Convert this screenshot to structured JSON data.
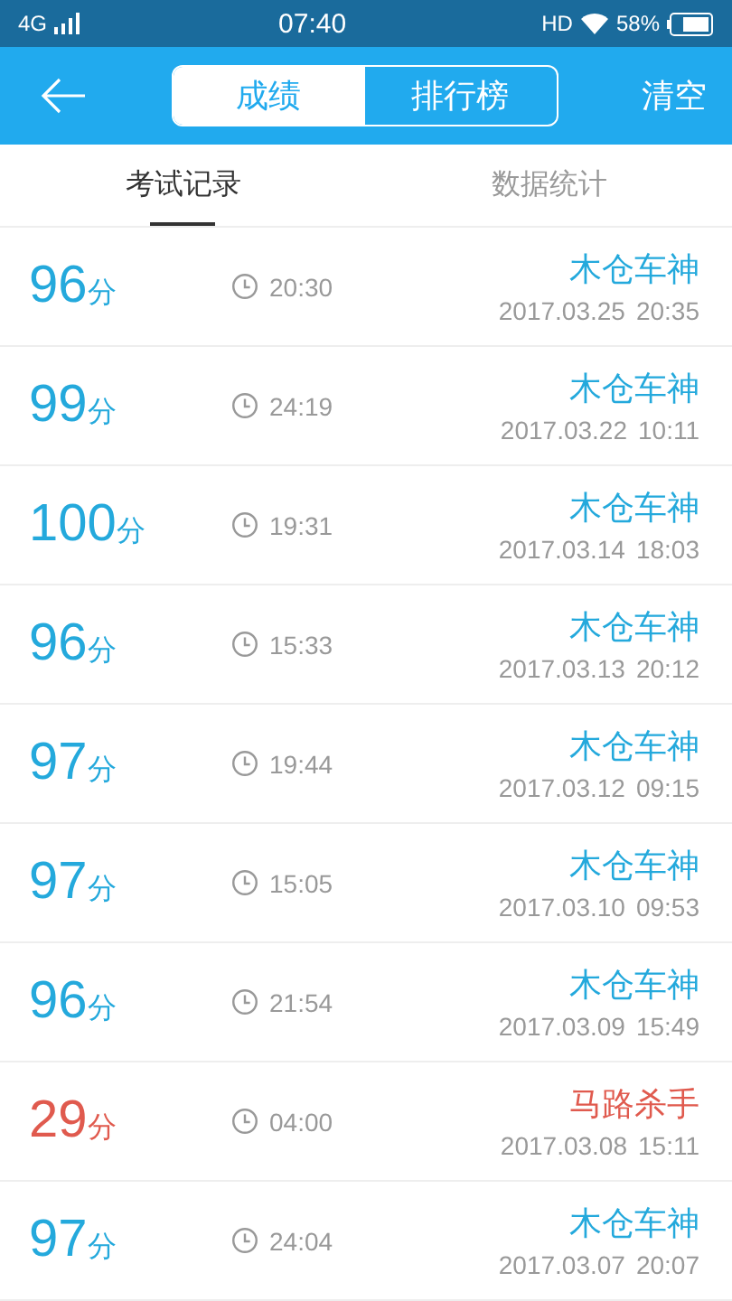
{
  "status_bar": {
    "network": "4G",
    "time": "07:40",
    "hd": "HD",
    "battery": "58%"
  },
  "header": {
    "segments": [
      {
        "label": "成绩",
        "selected": true
      },
      {
        "label": "排行榜",
        "selected": false
      }
    ],
    "action": "清空"
  },
  "tabs": [
    {
      "label": "考试记录",
      "selected": true
    },
    {
      "label": "数据统计",
      "selected": false
    }
  ],
  "records": [
    {
      "score": "96",
      "unit": "分",
      "duration": "20:30",
      "title": "木仓车神",
      "date": "2017.03.25",
      "time": "20:35",
      "passed": true
    },
    {
      "score": "99",
      "unit": "分",
      "duration": "24:19",
      "title": "木仓车神",
      "date": "2017.03.22",
      "time": "10:11",
      "passed": true
    },
    {
      "score": "100",
      "unit": "分",
      "duration": "19:31",
      "title": "木仓车神",
      "date": "2017.03.14",
      "time": "18:03",
      "passed": true
    },
    {
      "score": "96",
      "unit": "分",
      "duration": "15:33",
      "title": "木仓车神",
      "date": "2017.03.13",
      "time": "20:12",
      "passed": true
    },
    {
      "score": "97",
      "unit": "分",
      "duration": "19:44",
      "title": "木仓车神",
      "date": "2017.03.12",
      "time": "09:15",
      "passed": true
    },
    {
      "score": "97",
      "unit": "分",
      "duration": "15:05",
      "title": "木仓车神",
      "date": "2017.03.10",
      "time": "09:53",
      "passed": true
    },
    {
      "score": "96",
      "unit": "分",
      "duration": "21:54",
      "title": "木仓车神",
      "date": "2017.03.09",
      "time": "15:49",
      "passed": true
    },
    {
      "score": "29",
      "unit": "分",
      "duration": "04:00",
      "title": "马路杀手",
      "date": "2017.03.08",
      "time": "15:11",
      "passed": false
    },
    {
      "score": "97",
      "unit": "分",
      "duration": "24:04",
      "title": "木仓车神",
      "date": "2017.03.07",
      "time": "20:07",
      "passed": true
    }
  ]
}
